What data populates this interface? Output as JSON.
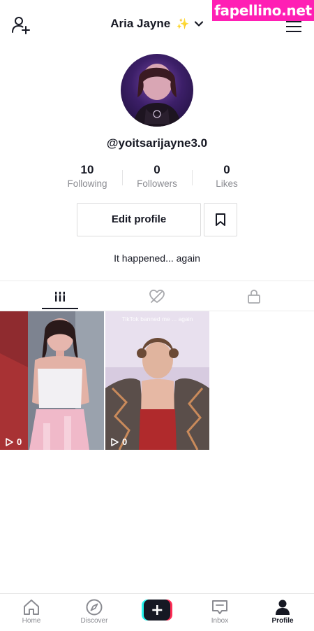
{
  "watermark": "fapellino.net",
  "header": {
    "title": "Aria Jayne",
    "sparkle": "✨"
  },
  "profile": {
    "username": "@yoitsarijayne3.0",
    "bio": "It happened... again",
    "edit_label": "Edit profile"
  },
  "stats": [
    {
      "value": "10",
      "label": "Following"
    },
    {
      "value": "0",
      "label": "Followers"
    },
    {
      "value": "0",
      "label": "Likes"
    }
  ],
  "tabs": [
    {
      "icon": "grid-icon",
      "active": true
    },
    {
      "icon": "liked-hidden-icon",
      "active": false
    },
    {
      "icon": "lock-icon",
      "active": false
    }
  ],
  "videos": [
    {
      "views": "0",
      "caption": ""
    },
    {
      "views": "0",
      "caption": "TikTok banned me ... again"
    }
  ],
  "nav": [
    {
      "label": "Home",
      "icon": "home-icon"
    },
    {
      "label": "Discover",
      "icon": "compass-icon"
    },
    {
      "label": "",
      "icon": "plus-icon"
    },
    {
      "label": "Inbox",
      "icon": "inbox-icon"
    },
    {
      "label": "Profile",
      "icon": "profile-icon",
      "active": true
    }
  ],
  "colors": {
    "text": "#161823",
    "muted": "#8a8b91",
    "watermark": "#ff1fb4",
    "plus_left": "#25f4ee",
    "plus_right": "#fe2c55"
  }
}
